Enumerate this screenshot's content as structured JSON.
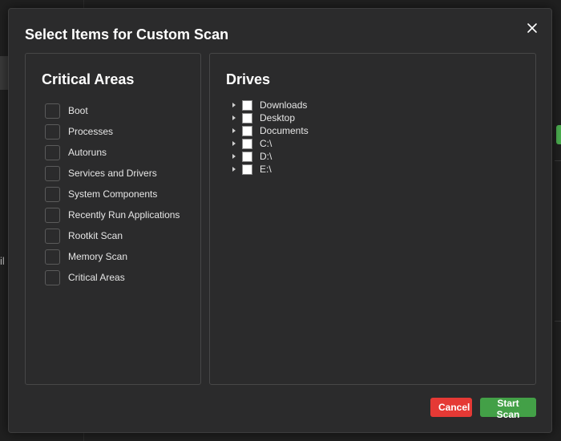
{
  "background": {
    "fragment_text": "il"
  },
  "dialog": {
    "title": "Select Items for Custom Scan",
    "close_icon": "close-icon"
  },
  "critical_areas": {
    "title": "Critical Areas",
    "items": [
      {
        "label": "Boot",
        "checked": false
      },
      {
        "label": "Processes",
        "checked": false
      },
      {
        "label": "Autoruns",
        "checked": false
      },
      {
        "label": "Services and Drivers",
        "checked": false
      },
      {
        "label": "System Components",
        "checked": false
      },
      {
        "label": "Recently Run Applications",
        "checked": false
      },
      {
        "label": "Rootkit Scan",
        "checked": false
      },
      {
        "label": "Memory Scan",
        "checked": false
      },
      {
        "label": "Critical Areas",
        "checked": false
      }
    ]
  },
  "drives": {
    "title": "Drives",
    "items": [
      {
        "label": "Downloads",
        "checked": false,
        "expanded": false
      },
      {
        "label": "Desktop",
        "checked": false,
        "expanded": false
      },
      {
        "label": "Documents",
        "checked": false,
        "expanded": false
      },
      {
        "label": "C:\\",
        "checked": false,
        "expanded": false
      },
      {
        "label": "D:\\",
        "checked": false,
        "expanded": false
      },
      {
        "label": "E:\\",
        "checked": false,
        "expanded": false
      }
    ]
  },
  "buttons": {
    "cancel": "Cancel",
    "start_scan": "Start Scan"
  },
  "colors": {
    "cancel": "#e53935",
    "start_scan": "#43a047",
    "dialog_bg": "#2b2b2c"
  }
}
